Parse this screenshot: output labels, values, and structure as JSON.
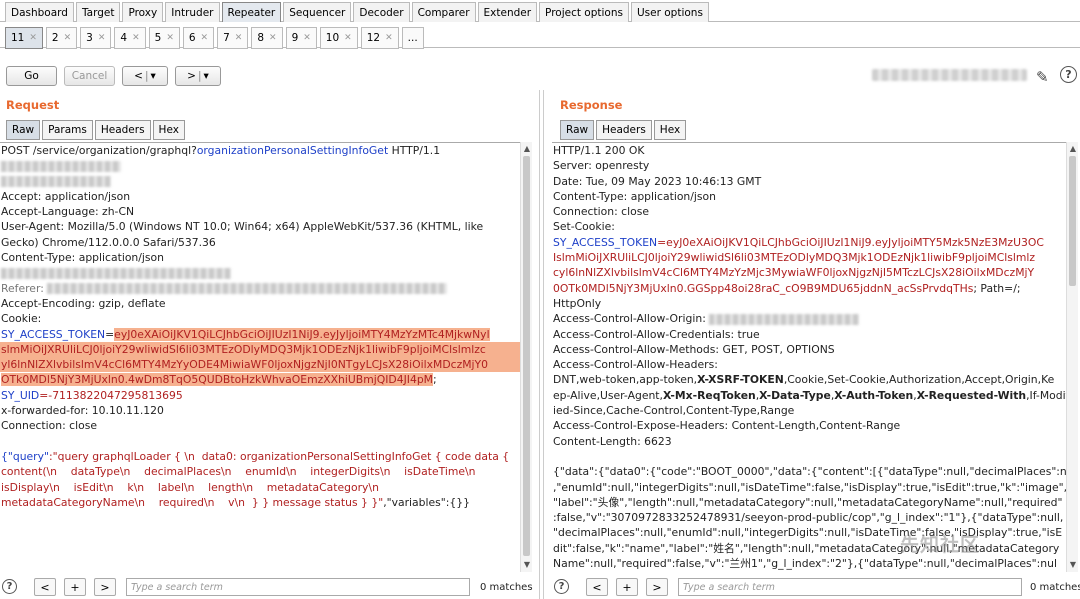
{
  "main_tabs": [
    "Dashboard",
    "Target",
    "Proxy",
    "Intruder",
    "Repeater",
    "Sequencer",
    "Decoder",
    "Comparer",
    "Extender",
    "Project options",
    "User options"
  ],
  "active_main_tab": "Repeater",
  "repeater_tabs": [
    "11",
    "2",
    "3",
    "4",
    "5",
    "6",
    "7",
    "8",
    "9",
    "10",
    "12",
    "..."
  ],
  "toolbar": {
    "go": "Go",
    "cancel": "Cancel",
    "back": "<",
    "back_menu": "▾",
    "forward": ">",
    "forward_menu": "▾",
    "help": "?"
  },
  "request": {
    "title": "Request",
    "tabs": [
      "Raw",
      "Params",
      "Headers",
      "Hex"
    ],
    "lines": {
      "l1a": "POST /service/organization/graphql?",
      "l1b": "organizationPersonalSettingInfoGet",
      "l1c": " HTTP/1.1",
      "accept": "Accept: application/json",
      "lang": "Accept-Language: zh-CN",
      "ua1": "User-Agent: Mozilla/5.0 (Windows NT 10.0; Win64; x64) AppleWebKit/537.36 (KHTML, like",
      "ua2": "Gecko) Chrome/112.0.0.0 Safari/537.36",
      "ctype": "Content-Type: application/json",
      "referer": "Referer:",
      "enc": "Accept-Encoding: gzip, deflate",
      "cookie": "Cookie:",
      "tok_name": "SY_ACCESS_TOKEN",
      "eq": "=",
      "tok1": "eyJ0eXAiOiJKV1QiLCJhbGciOiJIUzI1NiJ9.eyJyljoiMTY4MzYzMTc4MjkwNyl",
      "tok2": "slmMiOiJXRUliLCJ0ljoiY29wliwidSl6li03MTEzODlyMDQ3Mjk1ODEzNjk1liwibF9pljoiMClslmlzc",
      "tok3": "yl6lnNlZXlvbilslmV4cCl6MTY4MzYyODE4MiwiaWF0ljoxNjgzNjI0NTgyLCJsX28iOilxMDczMjY0",
      "tok4": "OTk0MDl5NjY3MjUxln0.4wDm8TqO5QUDBtoHzkWhvaOEmzXXhiUBmjQID4JI4pM",
      "tok_end": ";",
      "uid_name": "SY_UID",
      "uid_val": "=-7113822047295813695",
      "xff": "x-forwarded-for: 10.10.11.120",
      "conn": "Connection: close",
      "b1a": "{\"query\"",
      "b1b": ":\"query graphqlLoader { \\n  data0: organizationPersonalSettingInfoGet { code data {",
      "b2": "content(\\n    dataType\\n    decimalPlaces\\n    enumId\\n    integerDigits\\n    isDateTime\\n",
      "b3": "isDisplay\\n    isEdit\\n    k\\n    label\\n    length\\n    metadataCategory\\n",
      "b4a": "metadataCategoryName\\n    required\\n    v\\n  } } message status } }\"",
      "b4b": ",\"variables\":{}}"
    }
  },
  "response": {
    "title": "Response",
    "tabs": [
      "Raw",
      "Headers",
      "Hex"
    ],
    "lines": {
      "status": "HTTP/1.1 200 OK",
      "server": "Server: openresty",
      "date": "Date: Tue, 09 May 2023 10:46:13 GMT",
      "ctype": "Content-Type: application/json",
      "conn": "Connection: close",
      "setcookie": "Set-Cookie:",
      "tok_name": "SY_ACCESS_TOKEN",
      "tok1": "=eyJ0eXAiOiJKV1QiLCJhbGciOiJIUzI1NiJ9.eyJyljoiMTY5Mzk5NzE3MzU3OC",
      "tok2": "IslmMiOiJXRUliLCJ0ljoiY29wliwidSl6li03MTEzODlyMDQ3Mjk1ODEzNjk1liwibF9pljoiMClslmlz",
      "tok3": "cyl6lnNlZXlvbilslmV4cCl6MTY4MzYzMjc3MywiaWF0ljoxNjgzNjI5MTczLCJsX28iOilxMDczMjY",
      "tok4": "0OTk0MDl5NjY3MjUxln0.GGSpp48oi28raC_cO9B9MDU65jddnN_acSsPrvdqTHs",
      "tok_rest": "; Path=/;",
      "httponly": "HttpOnly",
      "acao": "Access-Control-Allow-Origin:",
      "acac": "Access-Control-Allow-Credentials: true",
      "acam": "Access-Control-Allow-Methods: GET, POST, OPTIONS",
      "acah": "Access-Control-Allow-Headers:",
      "h1": "DNT,web-token,app-token,",
      "h1b": "X-XSRF-TOKEN",
      "h1c": ",Cookie,Set-Cookie,Authorization,Accept,Origin,Ke",
      "h2": "ep-Alive,User-Agent,",
      "h2b": "X-Mx-ReqToken",
      "h2c": ",",
      "h2d": "X-Data-Type",
      "h2e": ",",
      "h2f": "X-Auth-Token",
      "h2g": ",",
      "h2h": "X-Requested-With",
      "h2i": ",If-Modif",
      "h3": "ied-Since,Cache-Control,Content-Type,Range",
      "aceh": "Access-Control-Expose-Headers: Content-Length,Content-Range",
      "clen": "Content-Length: 6623",
      "j1": "{\"data\":{\"data0\":{\"code\":\"BOOT_0000\",\"data\":{\"content\":[{\"dataType\":null,\"decimalPlaces\":null",
      "j2": ",\"enumId\":null,\"integerDigits\":null,\"isDateTime\":false,\"isDisplay\":true,\"isEdit\":true,\"k\":\"image\",",
      "j3": "\"label\":\"头像\",\"length\":null,\"metadataCategory\":null,\"metadataCategoryName\":null,\"required\"",
      "j4": ":false,\"v\":\"3070972833252478931/seeyon-prod-public/cop\",\"g_l_index\":\"1\"},{\"dataType\":null,",
      "j5": "\"decimalPlaces\":null,\"enumId\":null,\"integerDigits\":null,\"isDateTime\":false,\"isDisplay\":true,\"isE",
      "j6": "dit\":false,\"k\":\"name\",\"label\":\"姓名\",\"length\":null,\"metadataCategory\":null,\"metadataCategory",
      "j7": "Name\":null,\"required\":false,\"v\":\"兰州1\",\"g_l_index\":\"2\"},{\"dataType\":null,\"decimalPlaces\":nul"
    }
  },
  "search": {
    "placeholder": "Type a search term",
    "matches": "0 matches",
    "help": "?",
    "prev": "<",
    "add": "+",
    "next": ">"
  },
  "watermark": "先知社区"
}
